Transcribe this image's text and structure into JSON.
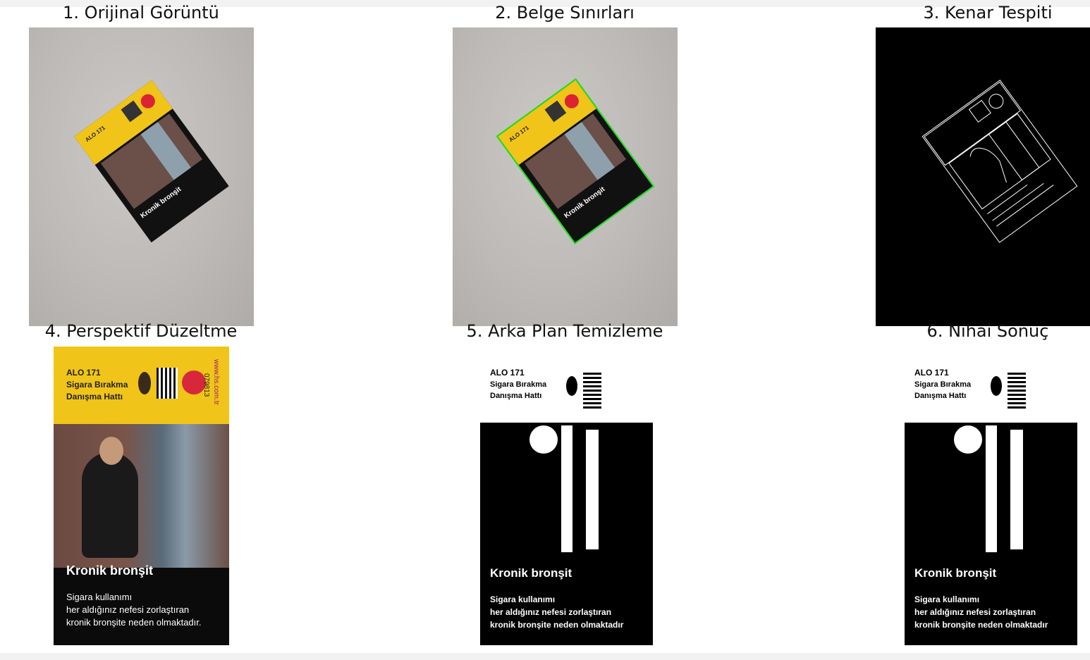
{
  "panels": [
    {
      "title": "1. Orijinal Görüntü"
    },
    {
      "title": "2. Belge Sınırları"
    },
    {
      "title": "3. Kenar Tespiti"
    },
    {
      "title": "4. Perspektif Düzeltme"
    },
    {
      "title": "5. Arka Plan Temizleme"
    },
    {
      "title": "6. Nihai Sonuç"
    }
  ],
  "pack": {
    "hotline": "ALO 171",
    "hotline_line2": "Sigara Bırakma",
    "hotline_line3": "Danışma Hattı",
    "warning_title": "Kronik bronşit",
    "warning_line1": "Sigara kullanımı",
    "warning_line2": "her aldığınız nefesi zorlaştıran",
    "warning_line3": "kronik bronşite neden olmaktadır.",
    "side_url": "www.hs.com.tr",
    "side_code": "079813"
  },
  "degraded_text": {
    "hotline_line2": "Sigara Bırakma",
    "hotline_line3": "Danışma Hattı",
    "warning_line1": "Sigara kullanımı",
    "warning_line2": "her aldığınız nefesi zorlaştıran",
    "warning_line3": "kronik bronşite neden olmaktadır"
  },
  "colors": {
    "boundary": "#19e019",
    "pack_yellow": "#f0c419"
  }
}
